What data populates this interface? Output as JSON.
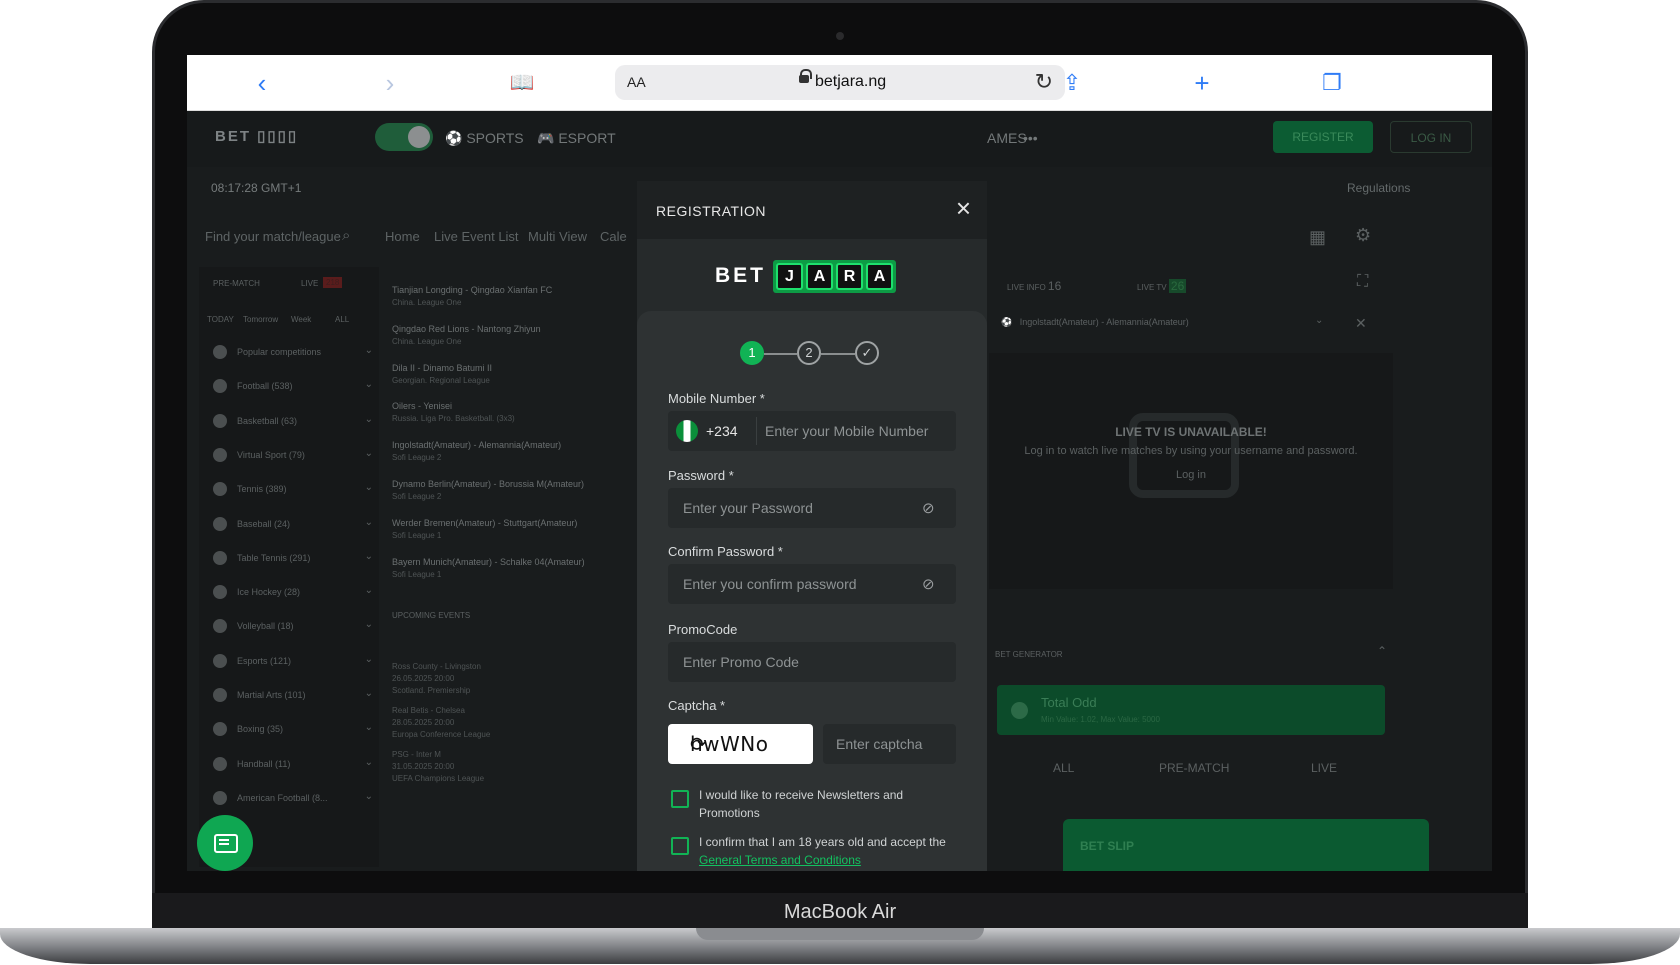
{
  "browser": {
    "text_size": "AA",
    "url": "betjara.ng"
  },
  "laptop_model": "MacBook Air",
  "site": {
    "logo_text": "BET",
    "nav": [
      "SPORTS",
      "ESPORT",
      "AMES",
      "•••"
    ],
    "register_label": "REGISTER",
    "login_label": "LOG IN",
    "time": "08:17:28 GMT+1",
    "regulations": "Regulations",
    "search_placeholder": "Find your match/league",
    "tabs": [
      "Home",
      "Live Event List",
      "Multi View",
      "Cale"
    ],
    "prematch": "PRE-MATCH",
    "live": "LIVE",
    "live_count": "218",
    "filters": [
      "TODAY",
      "Tomorrow",
      "Week",
      "ALL"
    ],
    "sports": [
      "Popular competitions",
      "Football (538)",
      "Basketball (63)",
      "Virtual Sport (79)",
      "Tennis (389)",
      "Baseball (24)",
      "Table Tennis (291)",
      "Ice Hockey (28)",
      "Volleyball (18)",
      "Esports (121)",
      "Martial Arts (101)",
      "Boxing (35)",
      "Handball (11)",
      "American Football (8..."
    ],
    "matches": [
      {
        "teams": "Tianjian Longding - Qingdao Xianfan FC",
        "league": "China. League One"
      },
      {
        "teams": "Qingdao Red Lions - Nantong Zhiyun",
        "league": "China. League One"
      },
      {
        "teams": "Dila II - Dinamo Batumi II",
        "league": "Georgian. Regional League"
      },
      {
        "teams": "Oilers - Yenisei",
        "league": "Russia. Liga Pro. Basketball. (3x3)"
      },
      {
        "teams": "Ingolstadt(Amateur) - Alemannia(Amateur)",
        "league": "Sofi League 2"
      },
      {
        "teams": "Dynamo Berlin(Amateur) - Borussia M(Amateur)",
        "league": "Sofi League 2"
      },
      {
        "teams": "Werder Bremen(Amateur) - Stuttgart(Amateur)",
        "league": "Sofi League 1"
      },
      {
        "teams": "Bayern Munich(Amateur) - Schalke 04(Amateur)",
        "league": "Sofi League 1"
      }
    ],
    "upcoming": "UPCOMING EVENTS",
    "upcoming_matches": [
      {
        "teams": "Ross County - Livingston",
        "date": "26.05.2025 20:00",
        "league": "Scotland. Premiership"
      },
      {
        "teams": "Real Betis - Chelsea",
        "date": "28.05.2025 20:00",
        "league": "Europa Conference League"
      },
      {
        "teams": "PSG - Inter M",
        "date": "31.05.2025 20:00",
        "league": "UEFA Champions League"
      }
    ],
    "live_info": "LIVE INFO",
    "live_info_count": "16",
    "live_tv": "LIVE TV",
    "live_tv_count": "26",
    "match_select": "Ingolstadt(Amateur) - Alemannia(Amateur)",
    "tv_unavailable": "LIVE TV IS UNAVAILABLE!",
    "tv_hint": "Log in to watch live matches by using your username and password.",
    "tv_login": "Log in",
    "bet_generator": "BET GENERATOR",
    "total_odd": "Total Odd",
    "total_odd_sub": "Min Value: 1.02, Max Value: 5000",
    "gen_tabs": [
      "ALL",
      "PRE-MATCH",
      "LIVE"
    ],
    "bet_slip": "BET SLIP"
  },
  "modal": {
    "title": "REGISTRATION",
    "logo_bet": "BET",
    "logo_tiles": [
      "J",
      "A",
      "R",
      "A"
    ],
    "steps": [
      "1",
      "2",
      "✓"
    ],
    "mobile_label": "Mobile Number *",
    "country_code": "+234",
    "mobile_placeholder": "Enter your Mobile Number",
    "password_label": "Password *",
    "password_placeholder": "Enter your Password",
    "confirm_label": "Confirm Password *",
    "confirm_placeholder": "Enter you confirm password",
    "promo_label": "PromoCode",
    "promo_placeholder": "Enter Promo Code",
    "captcha_label": "Captcha *",
    "captcha_text": "hwWNo",
    "captcha_placeholder": "Enter captcha",
    "newsletter_text": "I would like to receive Newsletters and Promotions",
    "terms_text": "I confirm that I am 18 years old and accept the",
    "terms_link": "General Terms and Conditions"
  },
  "colors": {
    "accent": "#11b355",
    "modal_bg": "#262a2b",
    "form_bg": "#2e3233"
  }
}
